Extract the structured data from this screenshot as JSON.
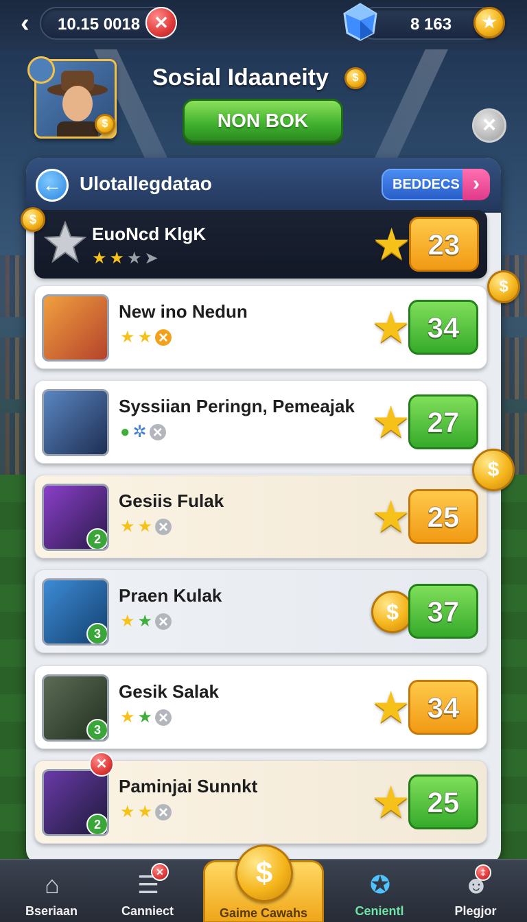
{
  "topbar": {
    "time_label": "10.15 0018",
    "currency_label": "8 163",
    "back_icon": "chevron-left-icon",
    "gem_icon": "blue-gem-icon"
  },
  "header": {
    "title": "Sosial Idaaneity",
    "main_button": "NON BOK"
  },
  "panel": {
    "title": "Ulotallegdatao",
    "tag_button": "BEDDECS",
    "featured": {
      "name": "EuoNcd KlgK",
      "score": "23",
      "score_color": "orange"
    },
    "rows": [
      {
        "name": "New ino Nedun",
        "score": "34",
        "score_color": "green",
        "level": ""
      },
      {
        "name": "Syssiian Peringn, Pemeajak",
        "score": "27",
        "score_color": "green",
        "level": ""
      },
      {
        "name": "Gesiis Fulak",
        "score": "25",
        "score_color": "orange",
        "level": "2"
      },
      {
        "name": "Praen Kulak",
        "score": "37",
        "score_color": "green",
        "level": "3"
      },
      {
        "name": "Gesik Salak",
        "score": "34",
        "score_color": "orange",
        "level": "3"
      },
      {
        "name": "Paminjai Sunnkt",
        "score": "25",
        "score_color": "green",
        "level": "2"
      }
    ]
  },
  "bottom_nav": {
    "items": [
      {
        "label": "Bseriaan",
        "icon": "house-icon"
      },
      {
        "label": "Canniect",
        "icon": "list-icon"
      },
      {
        "label": "Gaime Cawahs",
        "icon": "dollar-coin-icon"
      },
      {
        "label": "Cenientl",
        "icon": "compass-icon"
      },
      {
        "label": "Plegjor",
        "icon": "player-icon"
      }
    ]
  },
  "colors": {
    "accent_green": "#3fb02e",
    "accent_orange": "#f19a14",
    "accent_blue": "#2a5ec9",
    "coin_gold": "#f5b51c"
  }
}
